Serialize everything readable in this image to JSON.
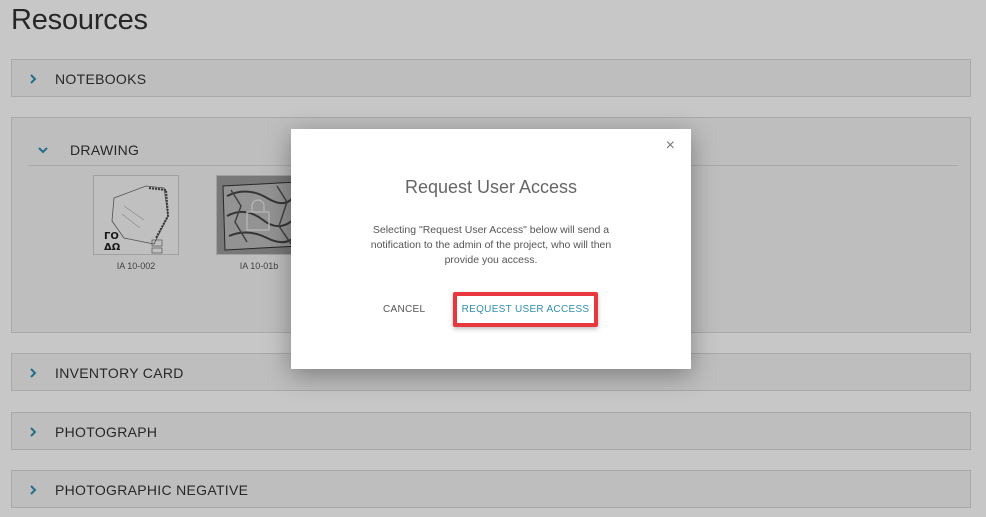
{
  "page": {
    "title": "Resources"
  },
  "sections": {
    "notebooks": {
      "label": "NOTEBOOKS"
    },
    "drawing": {
      "label": "DRAWING",
      "items": [
        {
          "caption": "IA 10-002"
        },
        {
          "caption": "IA 10-01b"
        }
      ]
    },
    "inventory": {
      "label": "INVENTORY CARD"
    },
    "photograph": {
      "label": "PHOTOGRAPH"
    },
    "negative": {
      "label": "PHOTOGRAPHIC NEGATIVE"
    }
  },
  "modal": {
    "title": "Request User Access",
    "body": "Selecting \"Request User Access\" below will send a notification to the admin of the project, who will then provide you access.",
    "cancel_label": "CANCEL",
    "request_label": "REQUEST USER ACCESS",
    "close_symbol": "×"
  },
  "colors": {
    "accent": "#2f8fae",
    "highlight": "#e8383d",
    "chevron": "#2f8fae"
  },
  "icons": {
    "section_collapsed": "chevron-right-icon",
    "section_expanded": "chevron-down-icon",
    "close": "close-icon",
    "lock": "lock-icon"
  }
}
